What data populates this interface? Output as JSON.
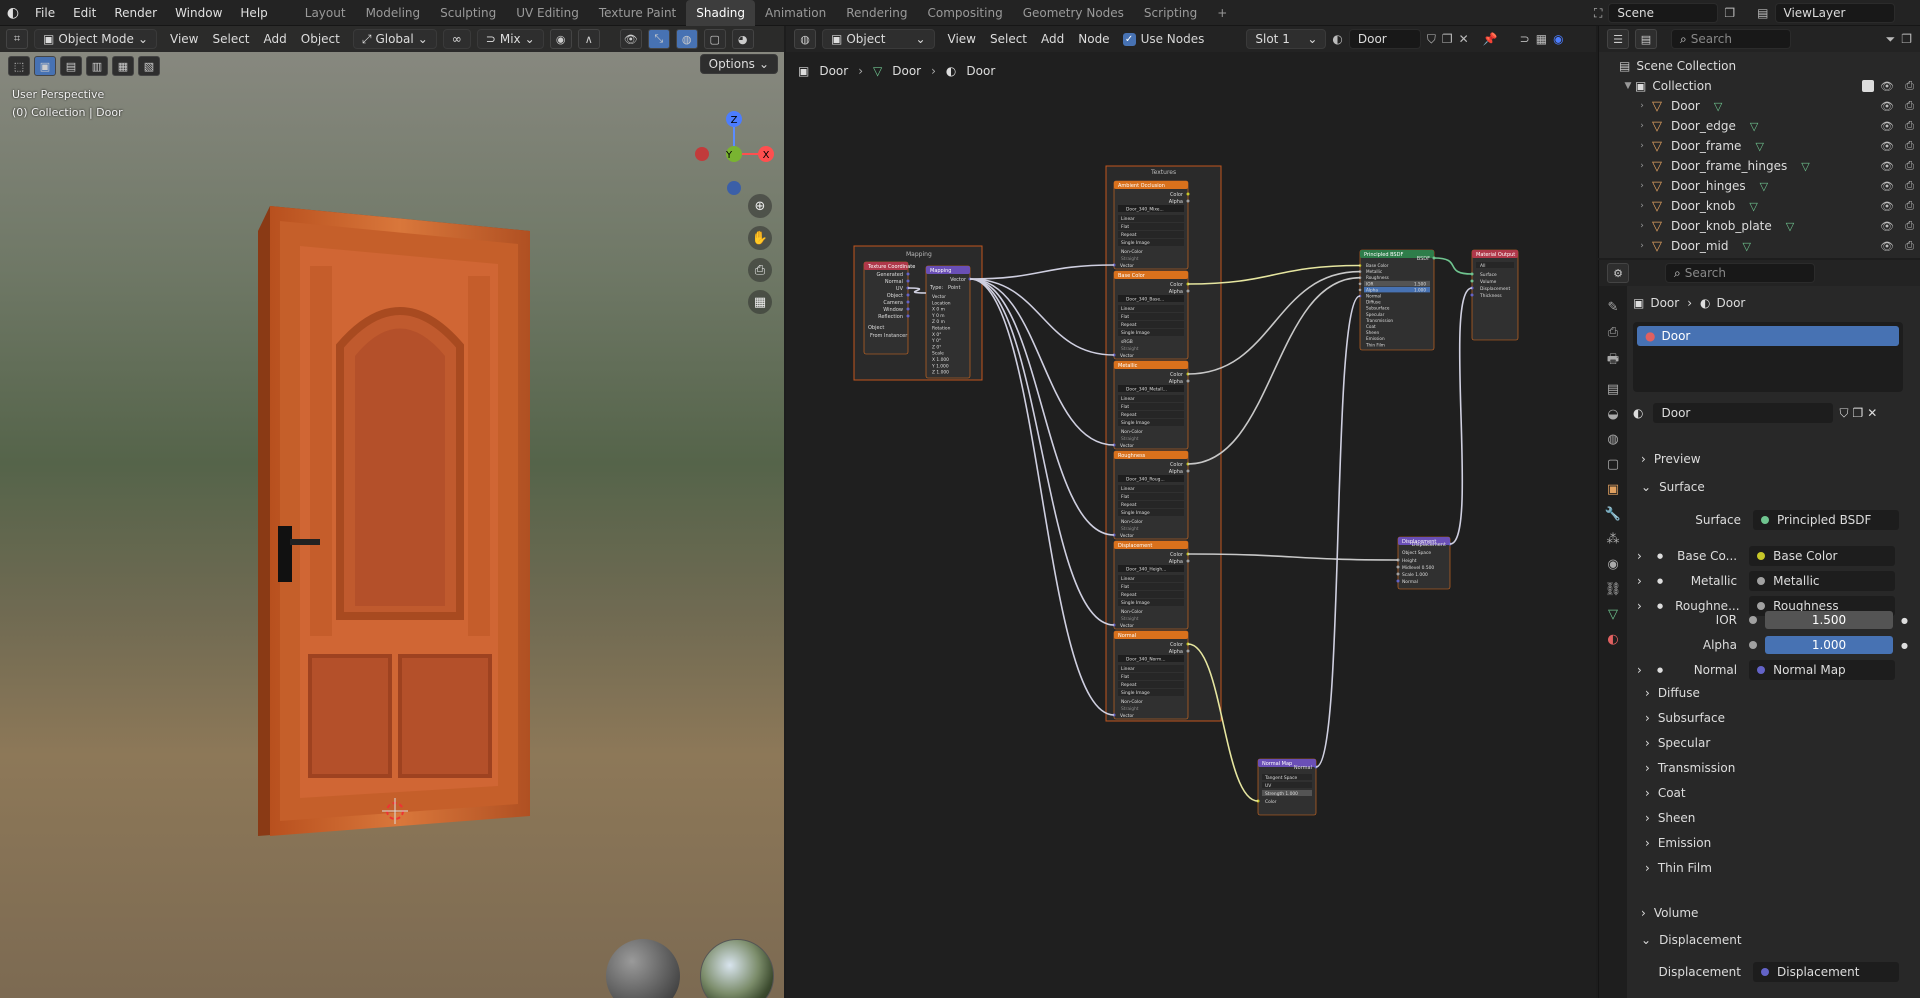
{
  "menu": [
    "File",
    "Edit",
    "Render",
    "Window",
    "Help"
  ],
  "workspaces": [
    {
      "label": "Layout",
      "active": false
    },
    {
      "label": "Modeling",
      "active": false
    },
    {
      "label": "Sculpting",
      "active": false
    },
    {
      "label": "UV Editing",
      "active": false
    },
    {
      "label": "Texture Paint",
      "active": false
    },
    {
      "label": "Shading",
      "active": true
    },
    {
      "label": "Animation",
      "active": false
    },
    {
      "label": "Rendering",
      "active": false
    },
    {
      "label": "Compositing",
      "active": false
    },
    {
      "label": "Geometry Nodes",
      "active": false
    },
    {
      "label": "Scripting",
      "active": false
    }
  ],
  "workspace_add": "+",
  "scene": {
    "name": "Scene",
    "view_layer": "ViewLayer"
  },
  "viewport": {
    "mode": "Object Mode",
    "menus": [
      "View",
      "Select",
      "Add",
      "Object"
    ],
    "orientation": "Global",
    "mix": "Mix",
    "options": "Options",
    "info_line1": "User Perspective",
    "info_line2": "(0) Collection | Door",
    "gizmo": {
      "z": "Z",
      "y": "Y",
      "x": "X"
    }
  },
  "node_editor": {
    "type": "Object",
    "menus": [
      "View",
      "Select",
      "Add",
      "Node"
    ],
    "use_nodes": "Use Nodes",
    "slot": "Slot 1",
    "material": "Door",
    "breadcrumb": [
      "Door",
      "Door",
      "Door"
    ],
    "frame_mapping": "Mapping",
    "frame_textures": "Textures",
    "node_texcoord": {
      "title": "Texture Coordinate",
      "outputs": [
        "Generated",
        "Normal",
        "UV",
        "Object",
        "Camera",
        "Window",
        "Reflection"
      ],
      "object_label": "Object",
      "instancer": "From Instancer"
    },
    "node_mapping": {
      "title": "Mapping",
      "out": "Vector",
      "type_label": "Type:",
      "type_value": "Point",
      "fields": [
        "Vector",
        "Location",
        "X  0 m",
        "Y  0 m",
        "Z  0 m",
        "Rotation",
        "X  0°",
        "Y  0°",
        "Z  0°",
        "Scale",
        "X  1.000",
        "Y  1.000",
        "Z  1.000"
      ]
    },
    "tex_rows": [
      "Linear",
      "Flat",
      "Repeat",
      "Single Image"
    ],
    "tex_nodes": [
      {
        "title": "Ambient Occlusion",
        "image": "Door_340_Mixe...",
        "colorspace": "Non-Color",
        "alpha": "Straight"
      },
      {
        "title": "Base Color",
        "image": "Door_340_Base...",
        "colorspace": "sRGB",
        "alpha": "Straight"
      },
      {
        "title": "Metallic",
        "image": "Door_340_Metall...",
        "colorspace": "Non-Color",
        "alpha": "Straight"
      },
      {
        "title": "Roughness",
        "image": "Door_340_Roug...",
        "colorspace": "Non-Color",
        "alpha": "Straight"
      },
      {
        "title": "Displacement",
        "image": "Door_340_Heigh...",
        "colorspace": "Non-Color",
        "alpha": "Straight"
      },
      {
        "title": "Normal",
        "image": "Door_340_Norm...",
        "colorspace": "Non-Color",
        "alpha": "Straight"
      }
    ],
    "tex_out": [
      "Color",
      "Alpha"
    ],
    "tex_vector": "Vector",
    "node_bsdf": {
      "title": "Principled BSDF",
      "out": "BSDF",
      "inputs": [
        "Base Color",
        "Metallic",
        "Roughness",
        "IOR",
        "Alpha",
        "Normal",
        "Diffuse",
        "Subsurface",
        "Specular",
        "Transmission",
        "Coat",
        "Sheen",
        "Emission",
        "Thin Film"
      ],
      "ior": "1.500",
      "alpha": "1.000"
    },
    "node_output": {
      "title": "Material Output",
      "target": "All",
      "inputs": [
        "Surface",
        "Volume",
        "Displacement",
        "Thickness"
      ]
    },
    "node_disp": {
      "title": "Displacement",
      "out": "Displacement",
      "space": "Object Space",
      "inputs": [
        "Height",
        "Midlevel  0.500",
        "Scale  1.000",
        "Normal"
      ]
    },
    "node_normal": {
      "title": "Normal Map",
      "out": "Normal",
      "space": "Tangent Space",
      "uv": "UV",
      "strength": "Strength  1.000",
      "color": "Color"
    }
  },
  "outliner": {
    "search": "Search",
    "root": "Scene Collection",
    "collection": "Collection",
    "items": [
      "Door",
      "Door_edge",
      "Door_frame",
      "Door_frame_hinges",
      "Door_hinges",
      "Door_knob",
      "Door_knob_plate",
      "Door_mid"
    ]
  },
  "properties": {
    "search": "Search",
    "crumb_object": "Door",
    "crumb_material": "Door",
    "slot_item": "Door",
    "material_name": "Door",
    "sections": {
      "preview": "Preview",
      "surface": "Surface",
      "volume": "Volume",
      "displacement": "Displacement"
    },
    "surface_label": "Surface",
    "surface_value": "Principled BSDF",
    "inputs": [
      {
        "label": "Base Co...",
        "value": "Base Color",
        "color": "#c7c729"
      },
      {
        "label": "Metallic",
        "value": "Metallic",
        "color": "#a1a1a1"
      },
      {
        "label": "Roughne...",
        "value": "Roughness",
        "color": "#a1a1a1"
      }
    ],
    "ior_label": "IOR",
    "ior_value": "1.500",
    "alpha_label": "Alpha",
    "alpha_value": "1.000",
    "normal_label": "Normal",
    "normal_value": "Normal Map",
    "subpanels": [
      "Diffuse",
      "Subsurface",
      "Specular",
      "Transmission",
      "Coat",
      "Sheen",
      "Emission",
      "Thin Film"
    ],
    "disp_label": "Displacement",
    "disp_value": "Displacement"
  },
  "colors": {
    "accent": "#4772b3",
    "node_tex_header": "#d9711c",
    "node_bsdf_header": "#2e7d4a",
    "node_vector_header": "#6a4fb6",
    "frame": "#c2561e"
  }
}
